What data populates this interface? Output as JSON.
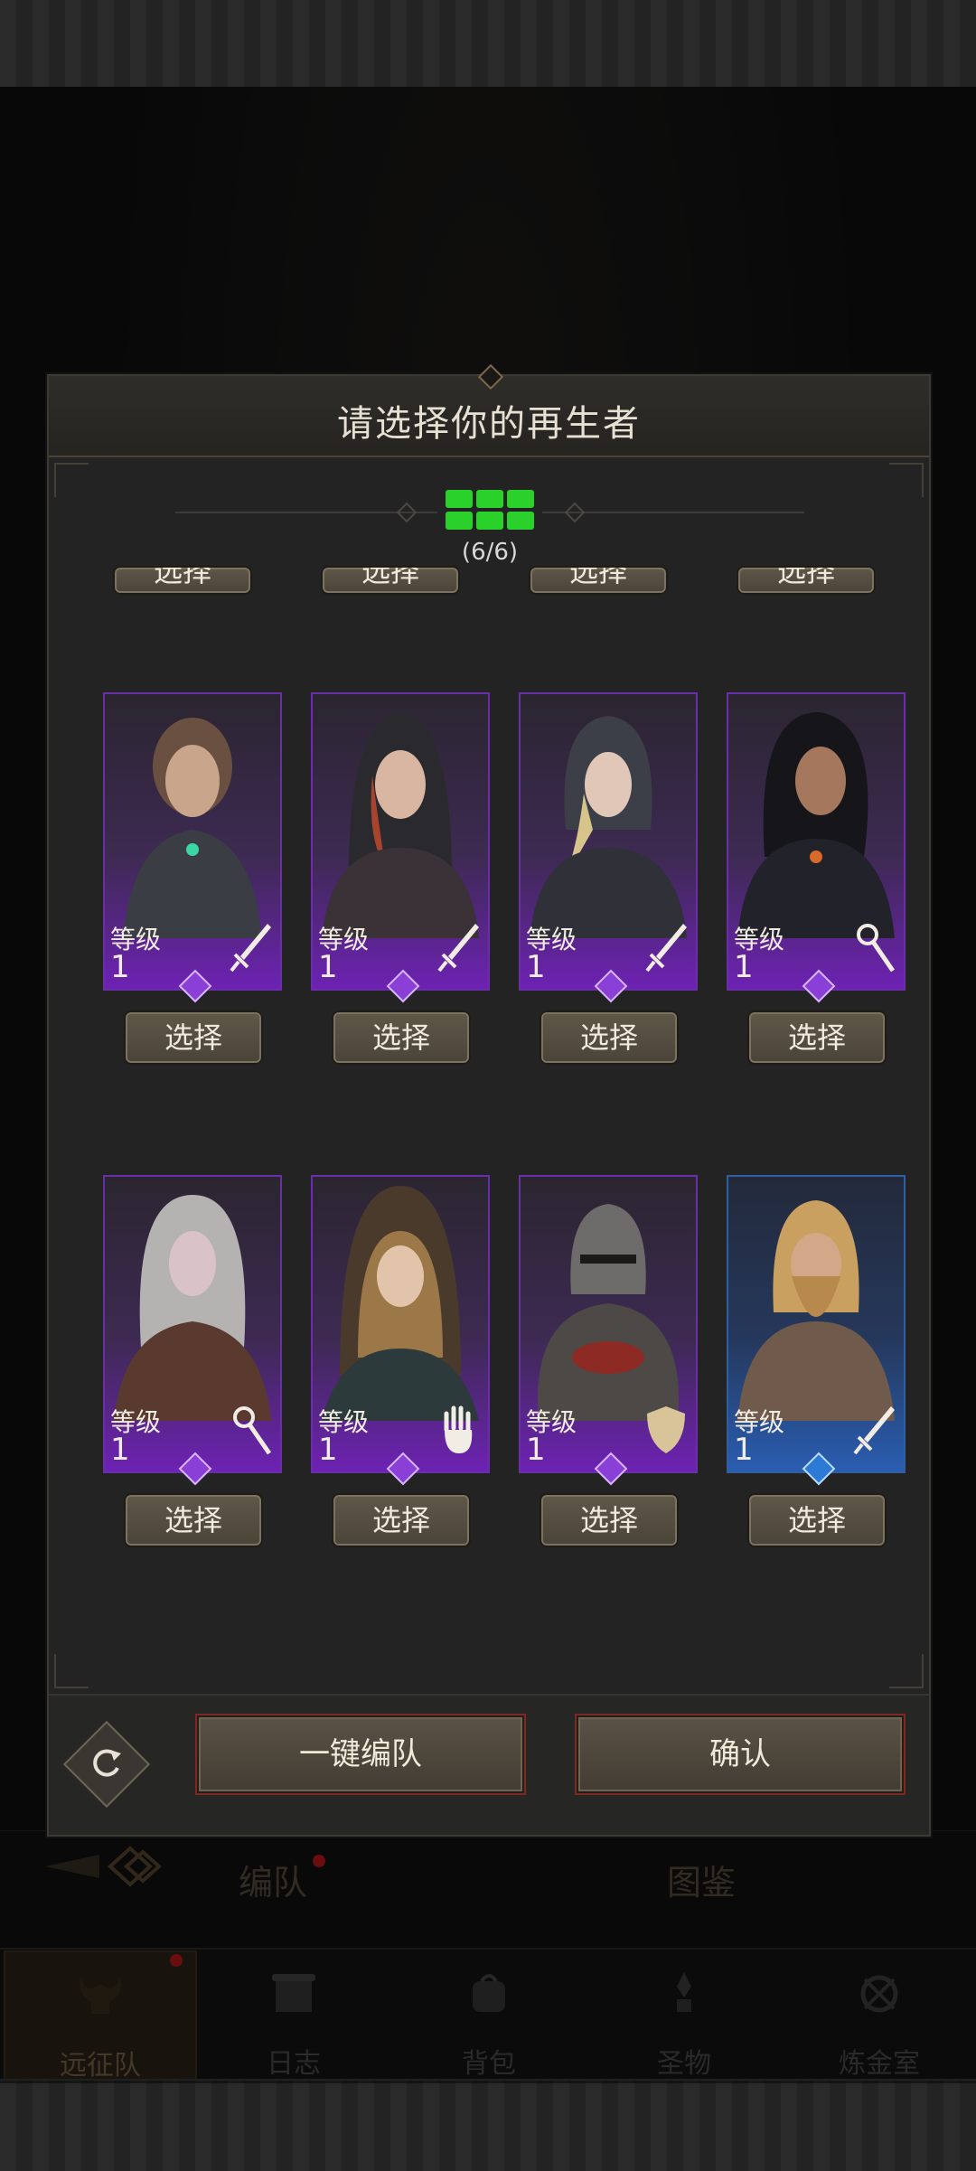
{
  "modal": {
    "title": "请选择你的再生者",
    "counter": "(6/6)",
    "select_label": "选择",
    "level_label": "等级",
    "auto_team_label": "一键编队",
    "confirm_label": "确认"
  },
  "heroes": [
    {
      "level": "1",
      "class_icon": "sword-icon",
      "frame": "purple"
    },
    {
      "level": "1",
      "class_icon": "sword-icon",
      "frame": "purple"
    },
    {
      "level": "1",
      "class_icon": "sword-icon",
      "frame": "purple"
    },
    {
      "level": "1",
      "class_icon": "staff-icon",
      "frame": "purple"
    },
    {
      "level": "1",
      "class_icon": "staff-icon",
      "frame": "purple"
    },
    {
      "level": "1",
      "class_icon": "hand-icon",
      "frame": "purple"
    },
    {
      "level": "1",
      "class_icon": "shield-icon",
      "frame": "purple"
    },
    {
      "level": "1",
      "class_icon": "sword-icon",
      "frame": "blue"
    }
  ],
  "background_tabs": {
    "team": "编队",
    "codex": "图鉴"
  },
  "nav": {
    "items": [
      {
        "label": "远征队",
        "icon": "horned-helmet-icon",
        "active": true
      },
      {
        "label": "日志",
        "icon": "scroll-icon",
        "active": false
      },
      {
        "label": "背包",
        "icon": "backpack-icon",
        "active": false
      },
      {
        "label": "圣物",
        "icon": "relic-icon",
        "active": false
      },
      {
        "label": "炼金室",
        "icon": "alchemy-icon",
        "active": false
      }
    ]
  },
  "colors": {
    "epic_frame": "#6d22b3",
    "rare_frame": "#2a5db1",
    "counter_green": "#2bd12b",
    "notification_red": "#c0191b"
  }
}
